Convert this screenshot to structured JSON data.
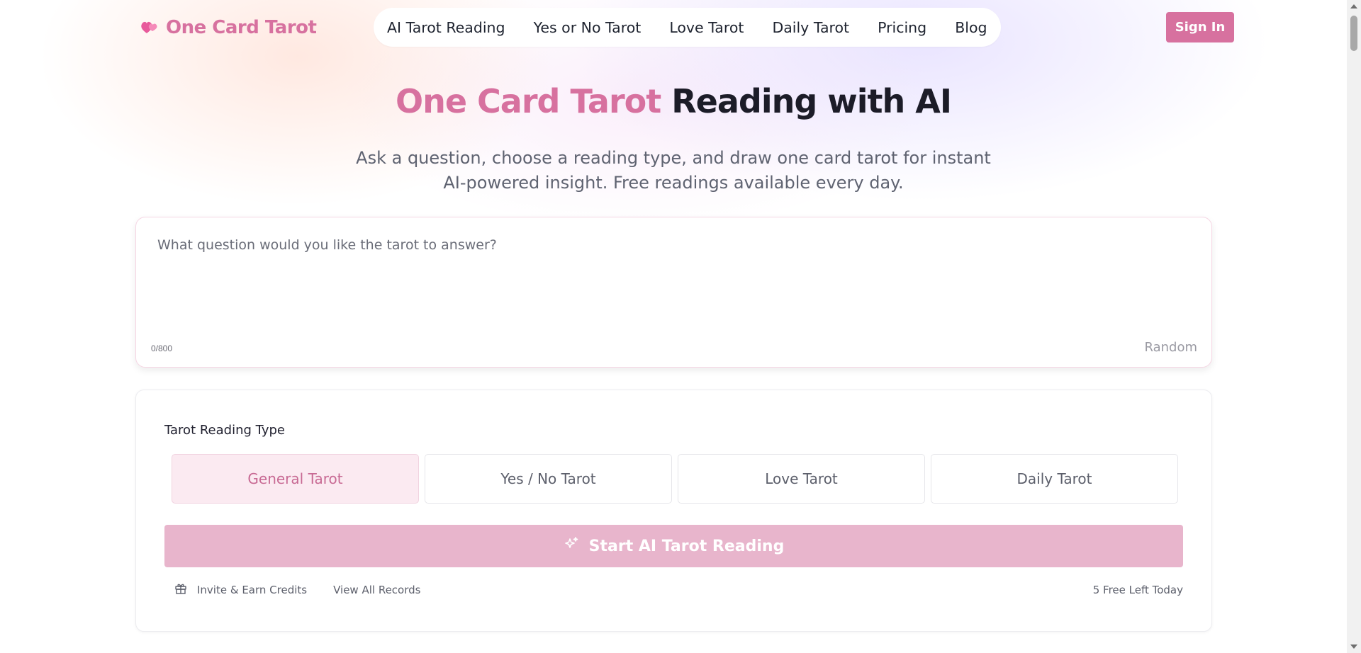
{
  "header": {
    "logo_text": "One Card Tarot",
    "logo_icon": "two-hearts-icon",
    "nav": [
      {
        "label": "AI Tarot Reading"
      },
      {
        "label": "Yes or No Tarot"
      },
      {
        "label": "Love Tarot"
      },
      {
        "label": "Daily Tarot"
      },
      {
        "label": "Pricing"
      },
      {
        "label": "Blog"
      }
    ],
    "signin_label": "Sign In"
  },
  "hero": {
    "title_accent": "One Card Tarot",
    "title_rest": "Reading with AI",
    "subtitle": "Ask a question, choose a reading type, and draw one card tarot for instant AI-powered insight. Free readings available every day."
  },
  "question": {
    "placeholder": "What question would you like the tarot to answer?",
    "value": "",
    "counter": "0/800",
    "random_label": "Random"
  },
  "reading": {
    "type_label": "Tarot Reading Type",
    "types": [
      {
        "label": "General Tarot",
        "active": true
      },
      {
        "label": "Yes / No Tarot",
        "active": false
      },
      {
        "label": "Love Tarot",
        "active": false
      },
      {
        "label": "Daily Tarot",
        "active": false
      }
    ],
    "start_label": "Start AI Tarot Reading",
    "start_icon": "sparkles-icon",
    "invite_label": "Invite & Earn Credits",
    "invite_icon": "gift-icon",
    "records_label": "View All Records",
    "free_left": "5 Free Left Today"
  },
  "colors": {
    "brand": "#d7719f",
    "start_button": "#e8b5cc",
    "active_type_bg": "#fbeaf1"
  }
}
